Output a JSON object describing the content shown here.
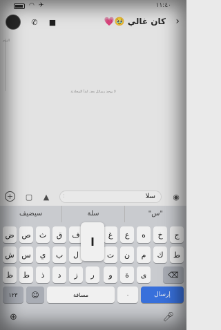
{
  "status_bar": {
    "time": "١١:٤٠"
  },
  "header": {
    "contact_name": "كان غالي 🥹💗"
  },
  "chat": {
    "empty_note": "لا يوجد رسائل بعد، ابدأ المحادثة",
    "timeline_label": "اليوم"
  },
  "composer": {
    "text": "سلا"
  },
  "keyboard": {
    "suggestions": [
      "سيضيف",
      "سلة",
      "\"س\""
    ],
    "row1": [
      "ض",
      "ص",
      "ث",
      "ق",
      "ف",
      "غ",
      "ع",
      "ه",
      "خ",
      "ح",
      "ج"
    ],
    "row2": [
      "ش",
      "س",
      "ي",
      "ب",
      "ل",
      "ا",
      "ت",
      "ن",
      "م",
      "ك",
      "ط"
    ],
    "row3": [
      "ظ",
      "ط",
      "ذ",
      "د",
      "ز",
      "ر",
      "و",
      "ة",
      "ى"
    ],
    "popup_char": "ا",
    "numbers_label": "١٢٣",
    "space_label": "مسافة",
    "send_label": "إرسال",
    "zero_label": "٠"
  }
}
